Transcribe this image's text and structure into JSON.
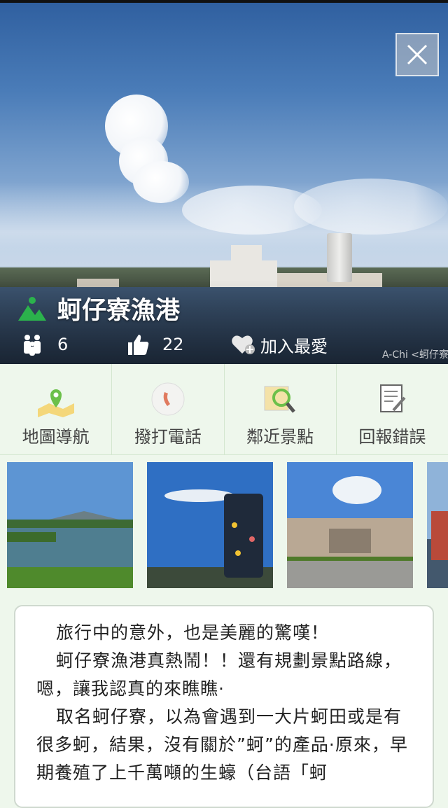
{
  "spot": {
    "title": "蚵仔寮漁港",
    "visitors": "6",
    "likes": "22",
    "favorite_label": "加入最愛",
    "photo_credit": "A-Chi <蚵仔寮"
  },
  "actions": [
    {
      "label": "地圖導航",
      "icon": "map-pin-icon"
    },
    {
      "label": "撥打電話",
      "icon": "phone-icon"
    },
    {
      "label": "鄰近景點",
      "icon": "map-search-icon"
    },
    {
      "label": "回報錯誤",
      "icon": "report-icon"
    }
  ],
  "colors": {
    "background": "#eef7ec",
    "accent_green": "#2bb24c",
    "divider": "#d3e6cf"
  },
  "description": {
    "p1": "旅行中的意外，也是美麗的驚嘆！",
    "p2": "蚵仔寮漁港真熱鬧！！還有規劃景點路線，嗯，讓我認真的來瞧瞧·",
    "p3": "取名蚵仔寮，以為會遇到一大片蚵田或是有很多蚵，結果，沒有關於”蚵”的產品·原來，早期養殖了上千萬噸的生蠔（台語「蚵"
  }
}
